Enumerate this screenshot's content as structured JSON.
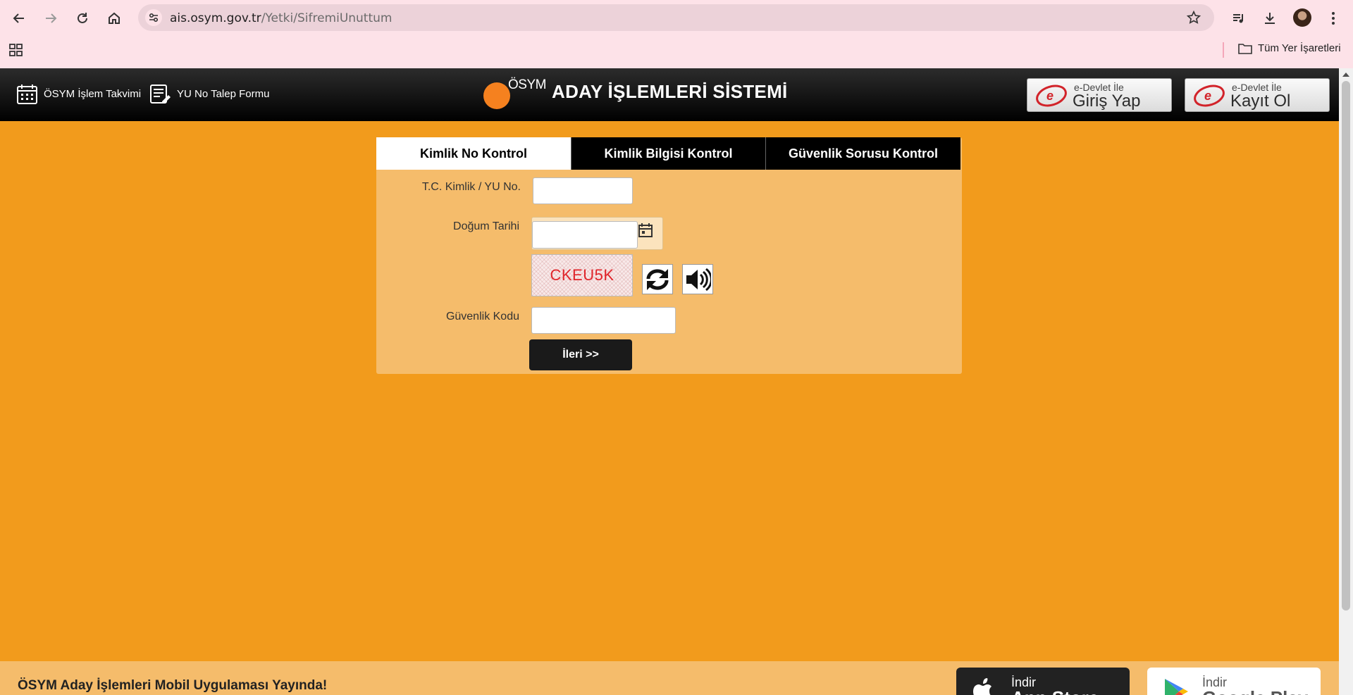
{
  "browser": {
    "url_host": "ais.osym.gov.tr",
    "url_path": "/Yetki/SifremiUnuttum",
    "bookmarks_folder": "Tüm Yer İşaretleri"
  },
  "header": {
    "calendar_link": "ÖSYM İşlem Takvimi",
    "yu_form_link": "YU No Talep Formu",
    "logo_text": "ÖSYM",
    "system_title": "ADAY İŞLEMLERİ SİSTEMİ",
    "edevlet_login": {
      "small": "e-Devlet İle",
      "big": "Giriş Yap"
    },
    "edevlet_register": {
      "small": "e-Devlet İle",
      "big": "Kayıt Ol"
    }
  },
  "tabs": [
    {
      "label": "Kimlik No Kontrol",
      "active": true
    },
    {
      "label": "Kimlik Bilgisi Kontrol",
      "active": false
    },
    {
      "label": "Güvenlik Sorusu Kontrol",
      "active": false
    }
  ],
  "form": {
    "tc_label": "T.C. Kimlik / YU No.",
    "tc_value": "",
    "birth_label": "Doğum Tarihi",
    "birth_value": "",
    "captcha_text": "CKEU5K",
    "security_label": "Güvenlik Kodu",
    "security_value": "",
    "submit_label": "İleri >>"
  },
  "footer": {
    "announcement": "ÖSYM Aday İşlemleri Mobil Uygulaması Yayında!",
    "app_store": {
      "small": "İndir",
      "big": "App Store"
    },
    "google_play": {
      "small": "İndir",
      "big": "Google Play"
    }
  },
  "colors": {
    "page_bg": "#f29b1c",
    "panel_bg": "#f5bc6b",
    "captcha_text": "#e0242a",
    "brand_orange": "#f5811f"
  }
}
